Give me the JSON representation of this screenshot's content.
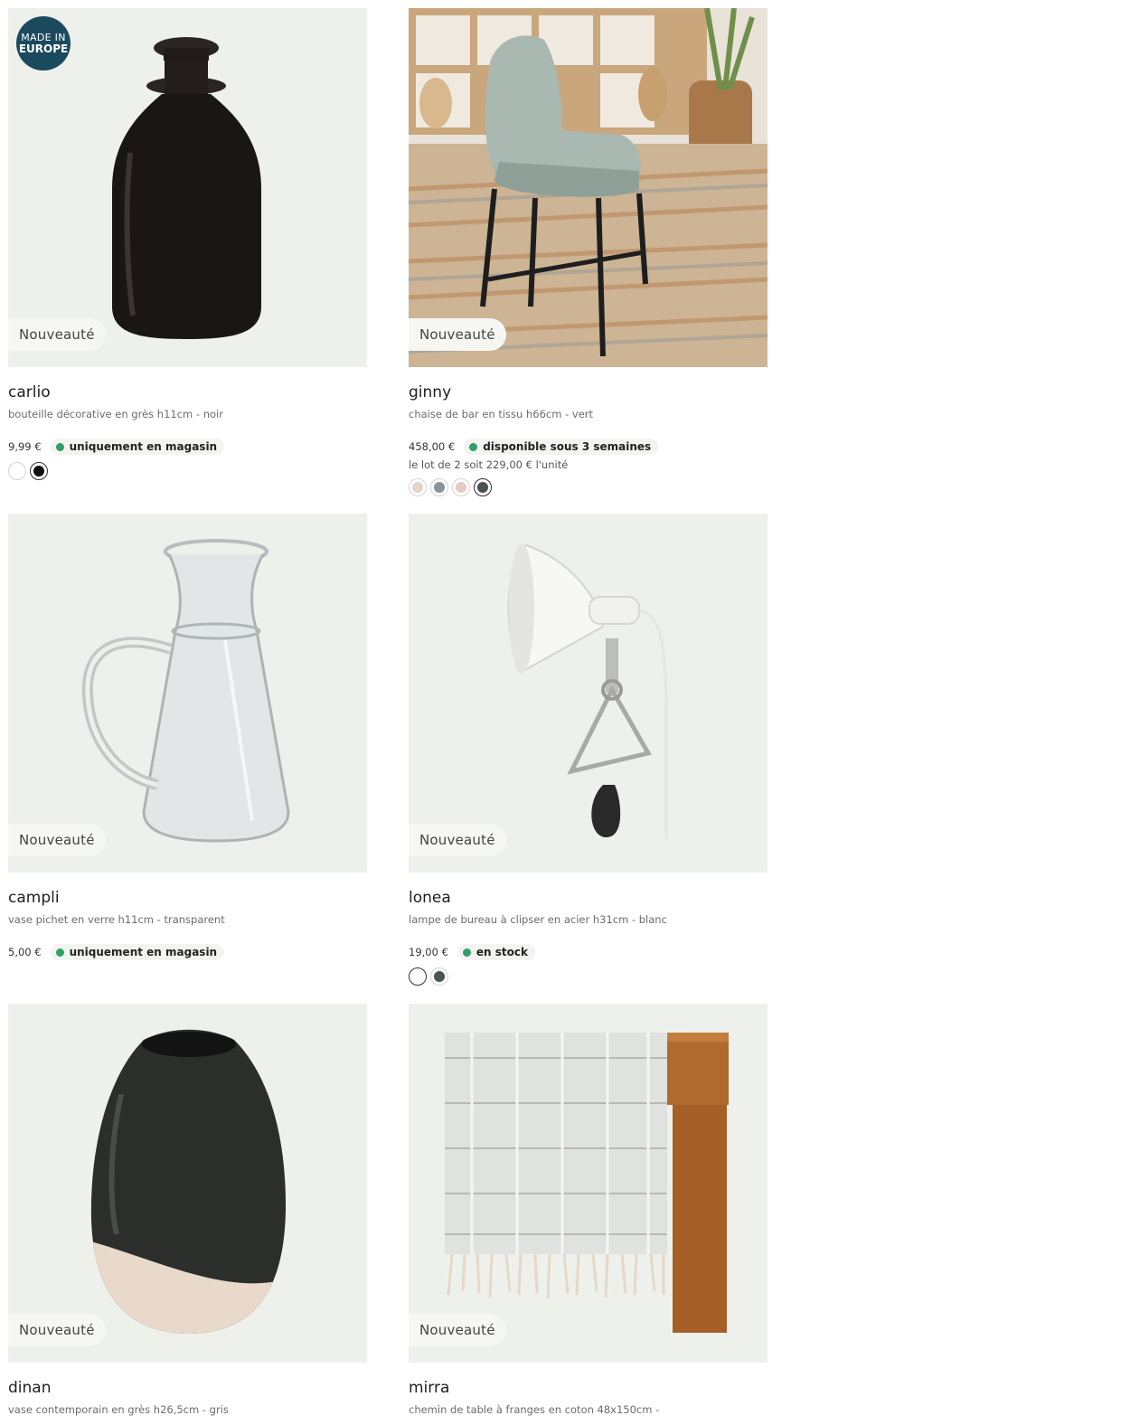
{
  "badge_new": "Nouveauté",
  "made_in": {
    "line1": "MADE IN",
    "line2": "EUROPE"
  },
  "products": [
    {
      "name": "carlio",
      "desc": "bouteille décorative en grès h11cm - noir",
      "price": "9,99 €",
      "stock": "uniquement en magasin",
      "swatches": [
        "#ffffff",
        "#111111"
      ]
    },
    {
      "name": "ginny",
      "desc": "chaise de bar en tissu h66cm - vert",
      "price": "458,00 €",
      "stock": "disponible sous 3 semaines",
      "lot": "le lot de 2 soit 229,00 € l'unité",
      "swatches": [
        "#e2d6c6",
        "#8a9599",
        "#e7c9bd",
        "#4a5250"
      ]
    },
    {
      "name": "campli",
      "desc": "vase pichet en verre h11cm - transparent",
      "price": "5,00 €",
      "stock": "uniquement en magasin",
      "swatches": []
    },
    {
      "name": "lonea",
      "desc": "lampe de bureau à clipser en acier h31cm - blanc",
      "price": "19,00 €",
      "stock": "en stock",
      "swatches": [
        "#ffffff",
        "#4b5552"
      ]
    },
    {
      "name": "dinan",
      "desc": "vase contemporain en grès h26,5cm - gris",
      "price": "",
      "stock": "",
      "swatches": []
    },
    {
      "name": "mirra",
      "desc": "chemin de table à franges en coton 48x150cm -",
      "price": "",
      "stock": "",
      "swatches": []
    }
  ]
}
